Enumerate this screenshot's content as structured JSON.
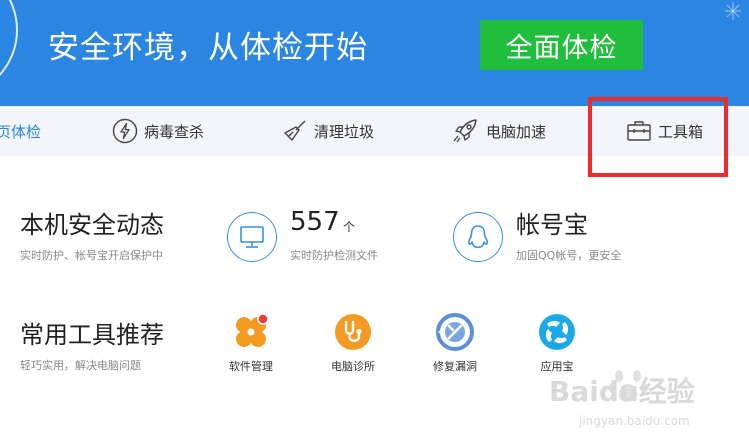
{
  "hero": {
    "title": "安全环境，从体检开始",
    "scan_button": "全面体检",
    "bg_color": "#2a86e2",
    "button_color": "#1fbe3c"
  },
  "nav": {
    "items": [
      {
        "label": "页体检",
        "icon": "none",
        "active": true
      },
      {
        "label": "病毒查杀",
        "icon": "lightning-icon"
      },
      {
        "label": "清理垃圾",
        "icon": "broom-icon"
      },
      {
        "label": "电脑加速",
        "icon": "rocket-icon"
      },
      {
        "label": "工具箱",
        "icon": "toolbox-icon"
      }
    ],
    "active_color": "#2a86e2",
    "highlight_color": "#ee2b2b"
  },
  "security": {
    "title": "本机安全动态",
    "subtitle": "实时防护、帐号宝开启保护中",
    "files": {
      "count": "557",
      "unit": "个",
      "label": "实时防护检测文件",
      "icon": "monitor-icon"
    },
    "account": {
      "title": "帐号宝",
      "label": "加固QQ帐号，更安全",
      "icon": "qq-penguin-icon"
    }
  },
  "tools": {
    "title": "常用工具推荐",
    "subtitle": "轻巧实用，解决电脑问题",
    "items": [
      {
        "label": "软件管理",
        "icon": "software-manager-icon",
        "color": "#f59a23"
      },
      {
        "label": "电脑诊所",
        "icon": "stethoscope-icon",
        "color": "#f59a23"
      },
      {
        "label": "修复漏洞",
        "icon": "repair-icon",
        "color": "#3a8ee6"
      },
      {
        "label": "应用宝",
        "icon": "app-store-icon",
        "color": "#1aa8e8"
      }
    ]
  },
  "watermark": {
    "brand_text": "Baidu经验",
    "url_text": "jingyan.baidu.com"
  }
}
